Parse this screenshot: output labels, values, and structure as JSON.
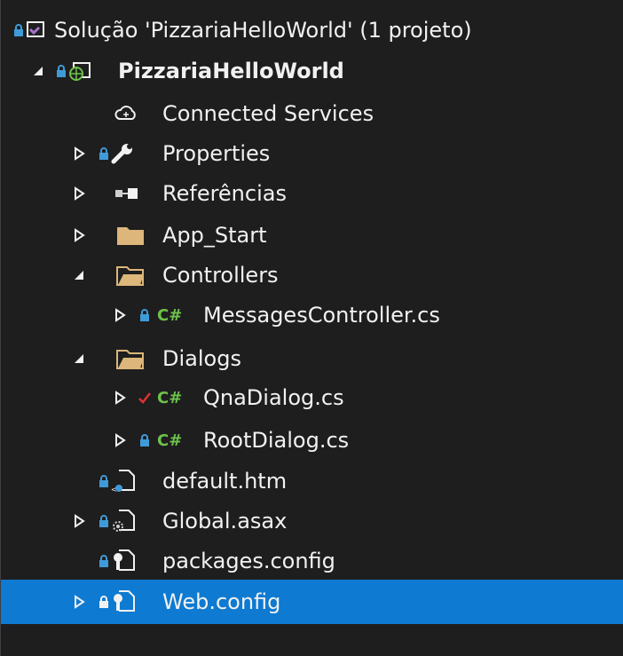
{
  "solution": {
    "label": "Solução 'PizzariaHelloWorld' (1 projeto)",
    "icon": "solution-icon"
  },
  "project": {
    "label": "PizzariaHelloWorld",
    "icon": "web-project-icon",
    "expanded": true
  },
  "items": [
    {
      "label": "Connected Services",
      "icon": "cloud-icon"
    },
    {
      "label": "Properties",
      "icon": "wrench-icon",
      "expanded": false
    },
    {
      "label": "Referências",
      "icon": "references-icon",
      "expanded": false
    },
    {
      "label": "App_Start",
      "icon": "folder-icon",
      "expanded": false
    },
    {
      "label": "Controllers",
      "icon": "folder-open-icon",
      "expanded": true
    },
    {
      "label": "MessagesController.cs",
      "icon": "csharp-icon",
      "expanded": false
    },
    {
      "label": "Dialogs",
      "icon": "folder-open-icon",
      "expanded": true
    },
    {
      "label": "QnaDialog.cs",
      "icon": "csharp-icon",
      "status": "checked-out",
      "expanded": false
    },
    {
      "label": "RootDialog.cs",
      "icon": "csharp-icon",
      "expanded": false
    },
    {
      "label": "default.htm",
      "icon": "html-file-icon"
    },
    {
      "label": "Global.asax",
      "icon": "asax-file-icon",
      "expanded": false
    },
    {
      "label": "packages.config",
      "icon": "config-file-icon"
    },
    {
      "label": "Web.config",
      "icon": "config-file-icon",
      "expanded": false,
      "selected": true
    }
  ],
  "colors": {
    "background": "#1e1e1e",
    "selection": "#0e7ad1",
    "text": "#f1f1f1",
    "lock": "#3f9ad8",
    "csharp": "#6cc24a",
    "checkmark": "#e03131",
    "folder": "#dcb67a"
  }
}
